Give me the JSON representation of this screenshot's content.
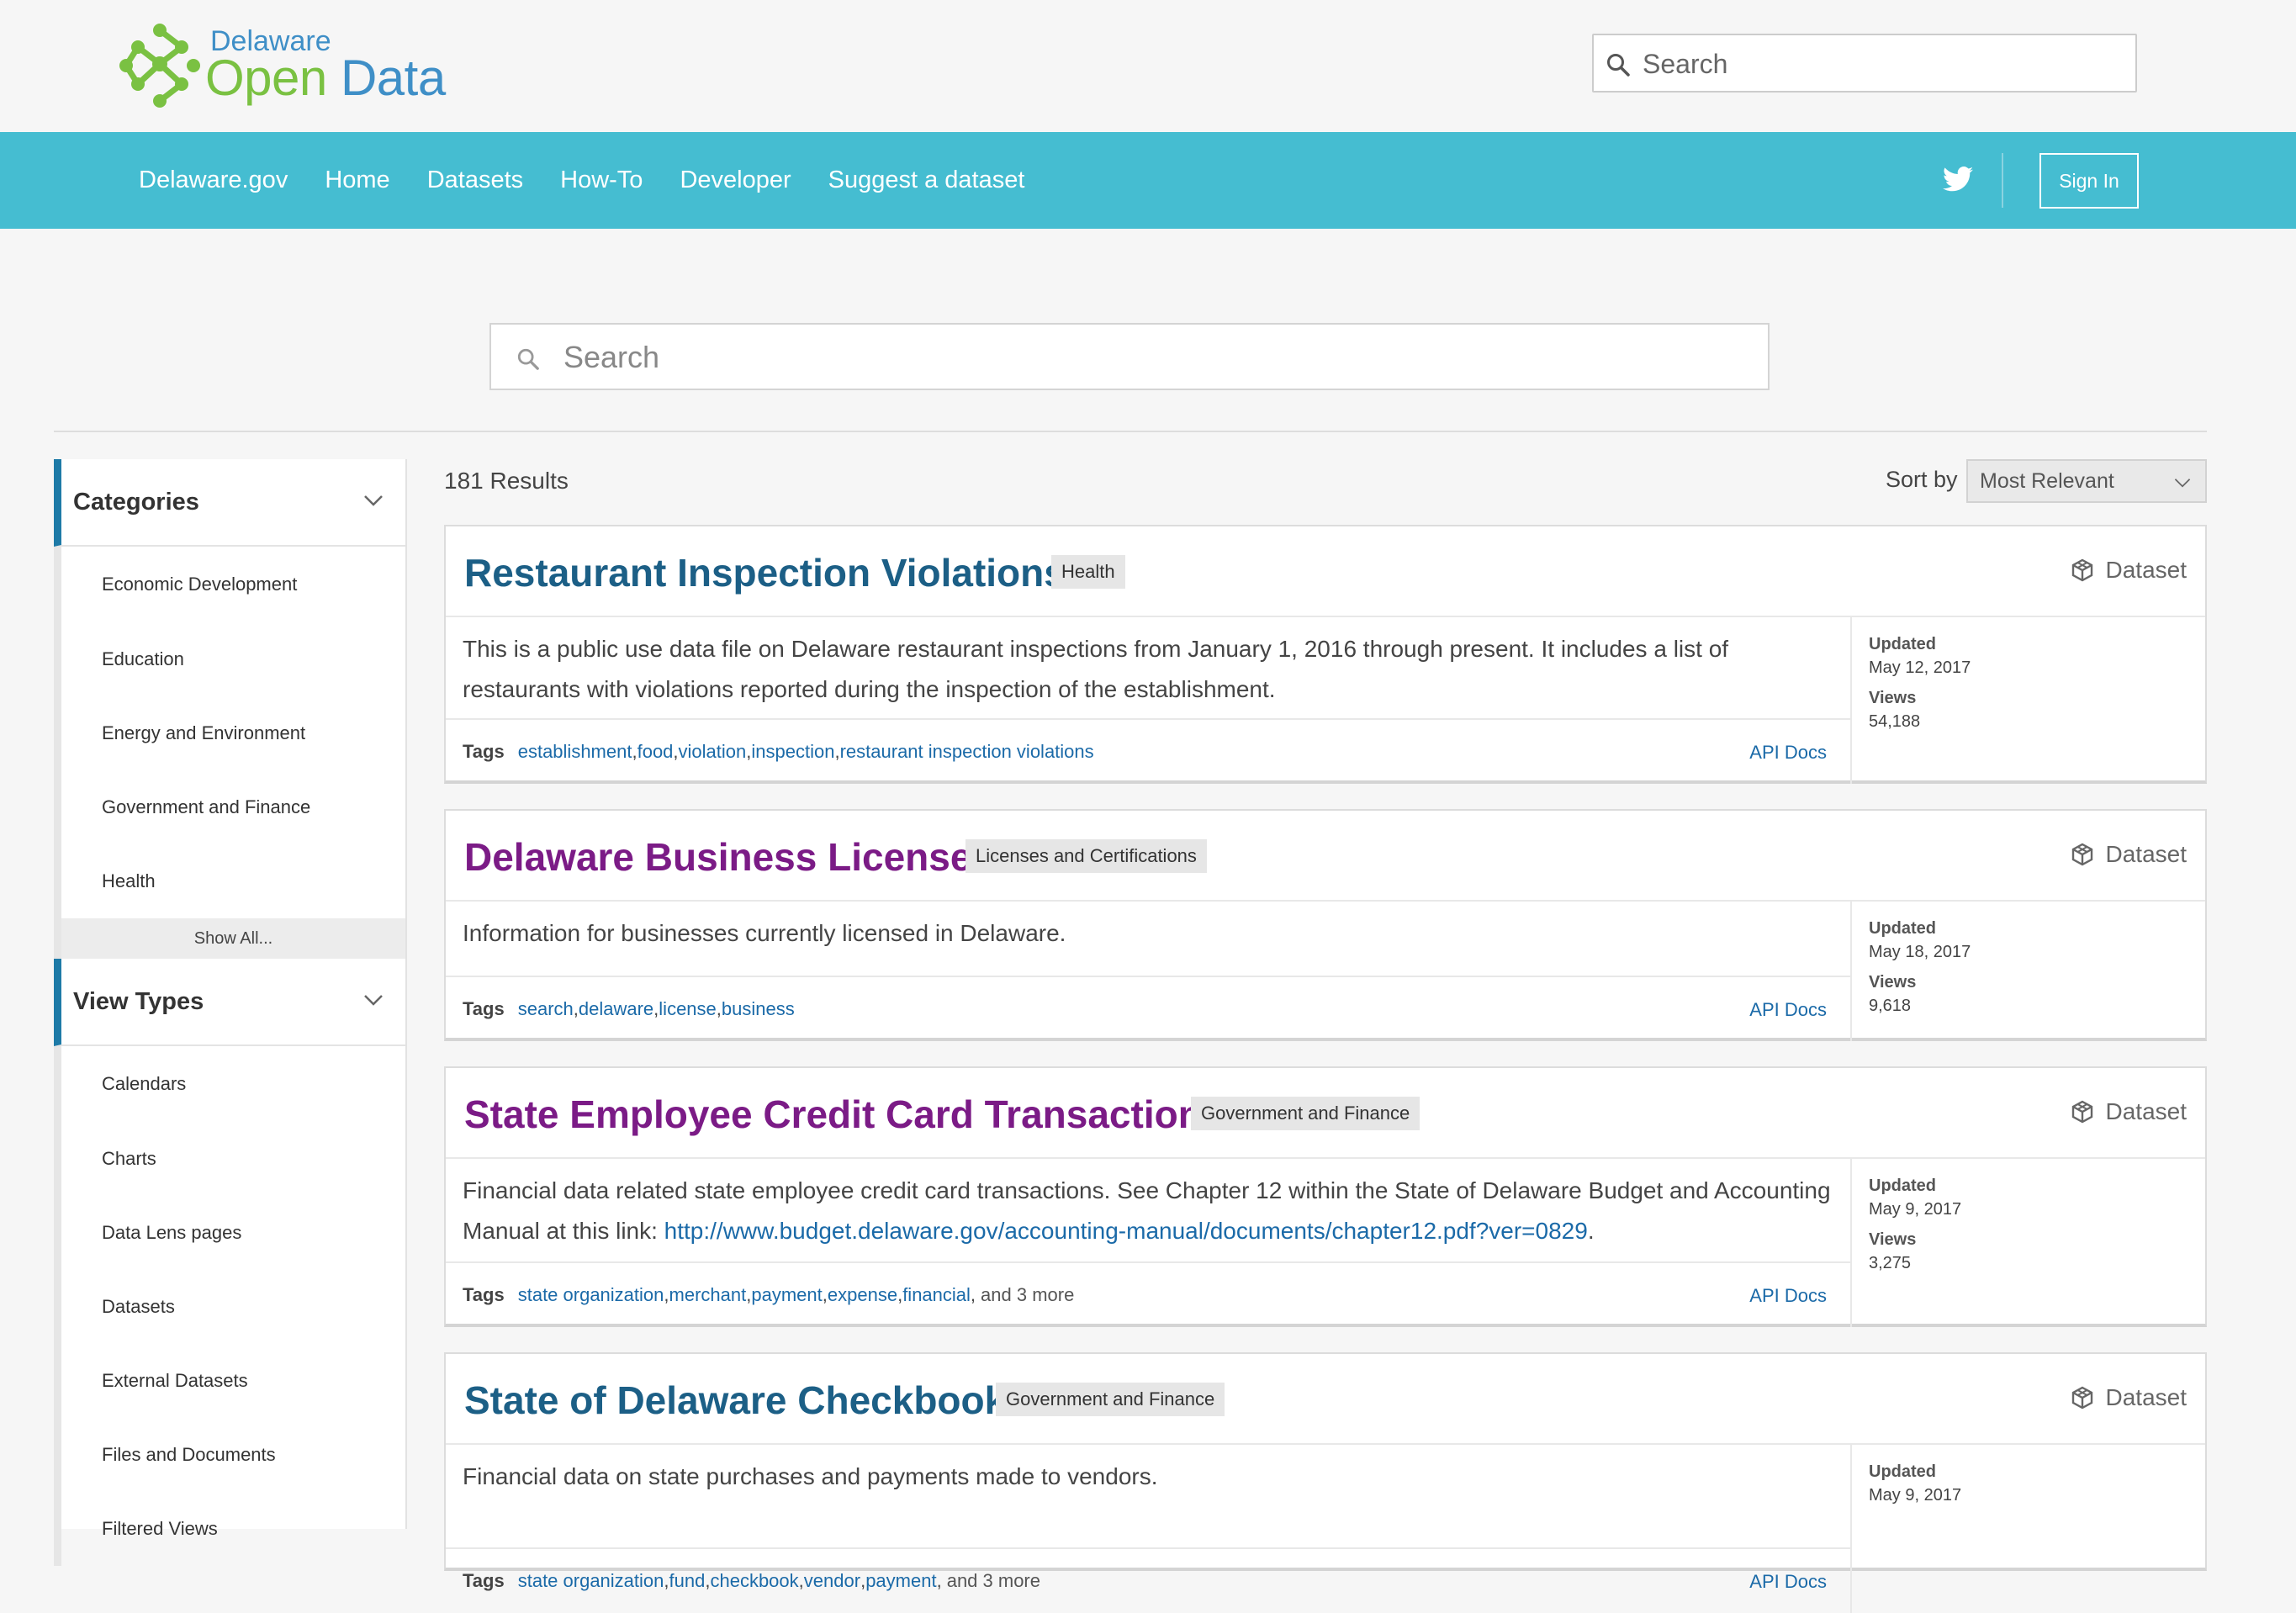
{
  "header": {
    "logo_small": "Delaware",
    "logo_big_o": "Open",
    "logo_big_rest": " Data",
    "search_placeholder": "Search"
  },
  "nav": {
    "links": [
      "Delaware.gov",
      "Home",
      "Datasets",
      "How-To",
      "Developer",
      "Suggest a dataset"
    ],
    "sign_in": "Sign In",
    "twitter_icon": "twitter-icon"
  },
  "main_search": {
    "placeholder": "Search"
  },
  "sidebar": {
    "categories": {
      "title": "Categories",
      "items": [
        "Economic Development",
        "Education",
        "Energy and Environment",
        "Government and Finance",
        "Health"
      ],
      "show_all": "Show All..."
    },
    "view_types": {
      "title": "View Types",
      "items": [
        "Calendars",
        "Charts",
        "Data Lens pages",
        "Datasets",
        "External Datasets",
        "Files and Documents",
        "Filtered Views"
      ]
    }
  },
  "results": {
    "count": "181 Results",
    "sort_label": "Sort by",
    "sort_value": "Most Relevant",
    "type_label": "Dataset",
    "tags_label": "Tags",
    "api_docs": "API Docs",
    "updated_label": "Updated",
    "views_label": "Views",
    "cards": [
      {
        "title": "Restaurant Inspection Violations",
        "category": "Health",
        "description": "This is a public use data file on Delaware restaurant inspections from January 1, 2016 through present. It includes a list of restaurants with violations reported during the inspection of the establishment.",
        "link": "",
        "tags": [
          "establishment",
          "food",
          "violation",
          "inspection",
          "restaurant inspection violations"
        ],
        "more": "",
        "updated": "May 12, 2017",
        "views": "54,188"
      },
      {
        "title": "Delaware Business Licenses",
        "category": "Licenses and Certifications",
        "description": "Information for businesses currently licensed in Delaware.",
        "link": "",
        "tags": [
          "search",
          "delaware",
          "license",
          "business"
        ],
        "more": "",
        "updated": "May 18, 2017",
        "views": "9,618"
      },
      {
        "title": "State Employee Credit Card Transactions",
        "category": "Government and Finance",
        "description": "Financial data related state employee credit card transactions. See Chapter 12 within the State of Delaware Budget and Accounting Manual at this link: ",
        "link": "http://www.budget.delaware.gov/accounting-manual/documents/chapter12.pdf?ver=0829",
        "tags": [
          "state organization",
          "merchant",
          "payment",
          "expense",
          "financial"
        ],
        "more": "and 3 more",
        "updated": "May 9, 2017",
        "views": "3,275"
      },
      {
        "title": "State of Delaware Checkbook",
        "category": "Government and Finance",
        "description": "Financial data on state purchases and payments made to vendors.",
        "link": "",
        "tags": [
          "state organization",
          "fund",
          "checkbook",
          "vendor",
          "payment"
        ],
        "more": "and 3 more",
        "updated": "May 9, 2017",
        "views": ""
      }
    ]
  },
  "colors": {
    "nav_bg": "#45bdd1",
    "link_blue": "#1b6aa8",
    "title_blue": "#1c5f86",
    "title_visited_purple": "#7b1b86",
    "facet_accent": "#1d7aa7",
    "logo_green": "#7ac142",
    "logo_blue": "#3f8fc7"
  }
}
